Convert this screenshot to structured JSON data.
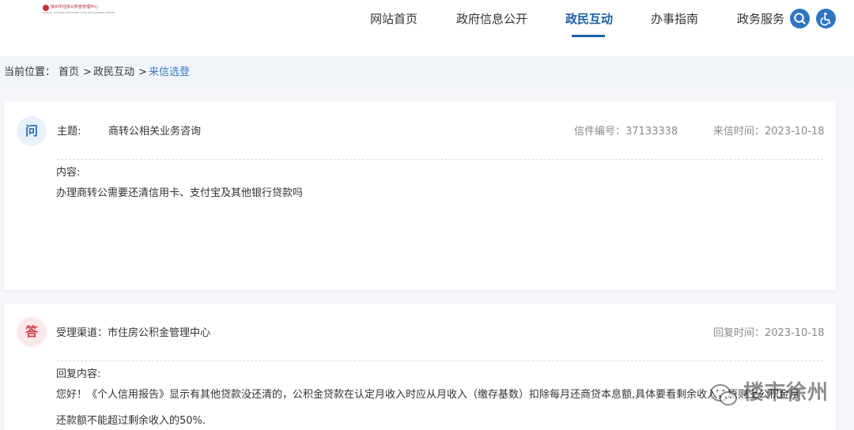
{
  "header": {
    "logo_text": "徐州市住房公积金管理中心",
    "logo_subtext": "XUZHOU HOUSING PROVIDENT FUND MANAGEMENT CENTER",
    "nav": [
      {
        "label": "网站首页"
      },
      {
        "label": "政府信息公开"
      },
      {
        "label": "政民互动",
        "active": true
      },
      {
        "label": "办事指南"
      },
      {
        "label": "政务服务"
      }
    ],
    "icons": [
      "search-icon",
      "accessibility-icon"
    ],
    "accent_color": "#1f5fa6"
  },
  "breadcrumb": {
    "prefix": "当前位置：",
    "items": [
      "首页",
      "政民互动",
      "来信选登"
    ],
    "separator": ">"
  },
  "question": {
    "badge": "问",
    "subject_label": "主题:",
    "subject": "商转公相关业务咨询",
    "letter_no": "信件编号：37133338",
    "date": "来信时间：2023-10-18",
    "content_label": "内容:",
    "content": "办理商转公需要还清信用卡、支付宝及其他银行贷款吗"
  },
  "answer": {
    "badge": "答",
    "channel": "受理渠道：市住房公积金管理中心",
    "date": "回复时间：2023-10-18",
    "content_label": "回复内容:",
    "content_line1": "您好！《个人信用报告》显示有其他贷款没还清的，公积金贷款在认定月收入时应从月收入（缴存基数）扣除每月还商贷本息额,具体要看剩余收入，原则上公积金月",
    "content_line2": "还款额不能超过剩余收入的50%."
  },
  "watermark": {
    "text": "楼市徐州"
  }
}
